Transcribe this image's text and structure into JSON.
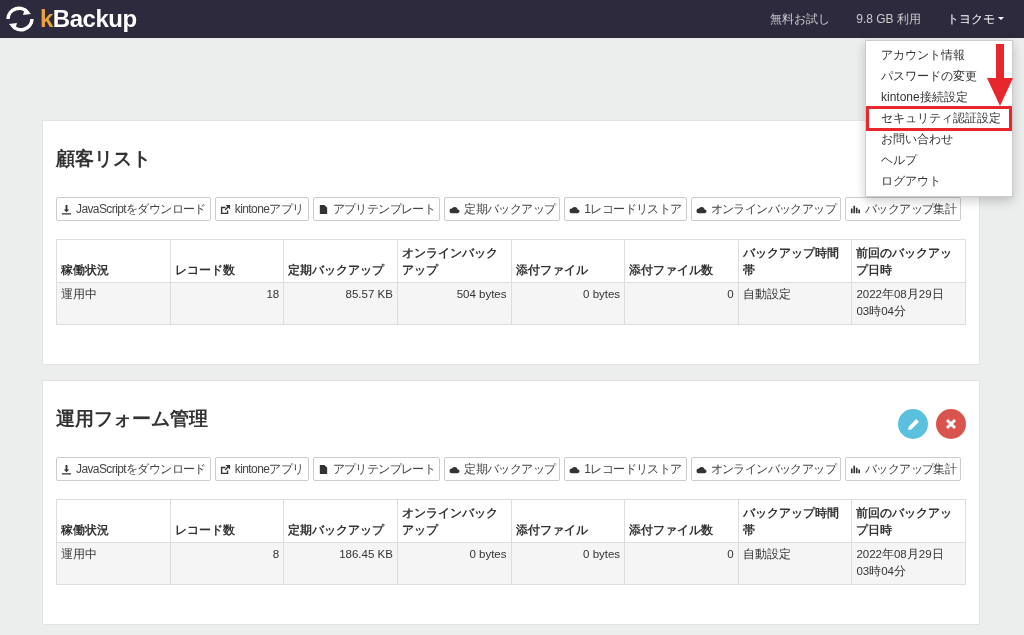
{
  "navbar": {
    "logo": "kBackup",
    "links": [
      "無料お試し",
      "9.8 GB 利用"
    ],
    "user": "トヨクモ"
  },
  "user_menu": {
    "expanded": true,
    "items": [
      {
        "label": "アカウント情報",
        "highlighted": false
      },
      {
        "label": "パスワードの変更",
        "highlighted": false
      },
      {
        "label": "kintone接続設定",
        "highlighted": false
      },
      {
        "label": "セキュリティ認証設定",
        "highlighted": true
      },
      {
        "label": "お問い合わせ",
        "highlighted": false
      },
      {
        "label": "ヘルプ",
        "highlighted": false
      },
      {
        "label": "ログアウト",
        "highlighted": false
      }
    ]
  },
  "apps": [
    {
      "title": "顧客リスト",
      "buttons": [
        "JavaScriptをダウンロード",
        "kintoneアプリ",
        "アプリテンプレート",
        "定期バックアップ",
        "1レコードリストア",
        "オンラインバックアップ",
        "バックアップ集計"
      ],
      "columns": [
        "稼働状況",
        "レコード数",
        "定期バックアップ",
        "オンラインバックアップ",
        "添付ファイル",
        "添付ファイル数",
        "バックアップ時間帯",
        "前回のバックアップ日時"
      ],
      "row": [
        "運用中",
        "18",
        "85.57 KB",
        "504 bytes",
        "0 bytes",
        "0",
        "自動設定",
        "2022年08月29日 03時04分"
      ]
    },
    {
      "title": "運用フォーム管理",
      "show_actions": true,
      "buttons": [
        "JavaScriptをダウンロード",
        "kintoneアプリ",
        "アプリテンプレート",
        "定期バックアップ",
        "1レコードリストア",
        "オンラインバックアップ",
        "バックアップ集計"
      ],
      "columns": [
        "稼働状況",
        "レコード数",
        "定期バックアップ",
        "オンラインバックアップ",
        "添付ファイル",
        "添付ファイル数",
        "バックアップ時間帯",
        "前回のバックアップ日時"
      ],
      "row": [
        "運用中",
        "8",
        "186.45 KB",
        "0 bytes",
        "0 bytes",
        "0",
        "自動設定",
        "2022年08月29日 03時04分"
      ]
    }
  ]
}
